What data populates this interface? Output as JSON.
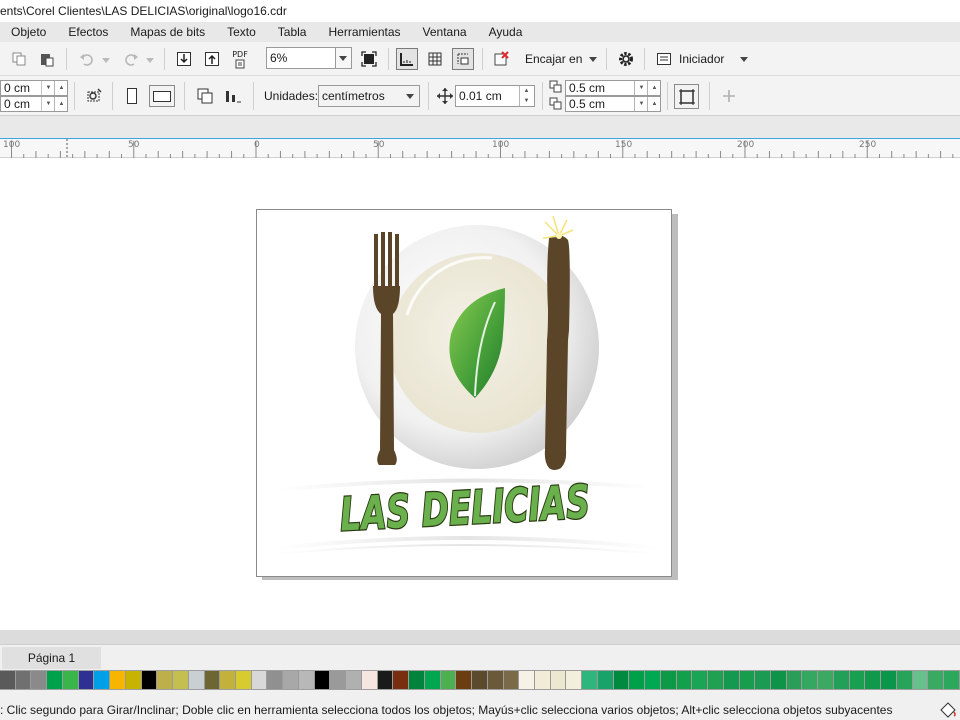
{
  "window": {
    "title": "ents\\Corel Clientes\\LAS DELICIAS\\original\\logo16.cdr"
  },
  "menu": {
    "items": [
      "Objeto",
      "Efectos",
      "Mapas de bits",
      "Texto",
      "Tabla",
      "Herramientas",
      "Ventana",
      "Ayuda"
    ]
  },
  "toolbar1": {
    "zoom_value": "6%",
    "pdf_label": "PDF",
    "snap_label": "Encajar en",
    "launcher_label": "Iniciador"
  },
  "toolbar2": {
    "pos_x_value": "0 cm",
    "pos_y_value": "0 cm",
    "units_label": "Unidades:",
    "units_value": "centímetros",
    "nudge_value": "0.01 cm",
    "dup_x_value": "0.5 cm",
    "dup_y_value": "0.5 cm"
  },
  "ruler": {
    "labels": [
      "100",
      "50",
      "0",
      "50",
      "100",
      "150",
      "200",
      "250"
    ]
  },
  "artwork": {
    "logo_text": "LAS DELICIAS",
    "colors": {
      "utensils": "#5a4528",
      "leaf_light": "#7cc04a",
      "leaf_dark": "#2e8b2e",
      "text_fill": "#6ab04c",
      "text_outline": "#2a3a12",
      "plate_rim": "#d6d6d6",
      "plate_center": "#eeeadb"
    }
  },
  "page_tabs": {
    "page_label": "Página 1"
  },
  "palette": {
    "swatches": [
      "#5a5a5a",
      "#707070",
      "#8a8a8a",
      "#00a14b",
      "#39b54a",
      "#2e3192",
      "#00a0e9",
      "#f7b500",
      "#c8b400",
      "#000000",
      "#bdb04a",
      "#c4bf4e",
      "#c8d0d4",
      "#6d6532",
      "#c2b13a",
      "#d6cc30",
      "#d8d8d8",
      "#909090",
      "#a8a8a8",
      "#b8b8b8",
      "#000000",
      "#9a9a9a",
      "#b0b0b0",
      "#f5e6e0",
      "#1a1a1a",
      "#7a2e10",
      "#00843d",
      "#00a650",
      "#4caf50",
      "#6b3e12",
      "#5c4a2e",
      "#6a5a3a",
      "#7a6a48",
      "#f7f2e8",
      "#f0ecd8",
      "#ece8d0",
      "#f2f0dc",
      "#2eb67d",
      "#17a36a",
      "#008a40",
      "#00a04a",
      "#00a852",
      "#0c9a48",
      "#12a04c",
      "#1aa455",
      "#20a050",
      "#149950",
      "#189c4e",
      "#1a9a52",
      "#0e9448",
      "#2a9e58",
      "#34a860",
      "#3ca862",
      "#22a05a",
      "#18a050",
      "#10994a",
      "#0a964a",
      "#25a45a",
      "#68c08c",
      "#3aaa62",
      "#2aa85c"
    ]
  },
  "status": {
    "hint": ": Clic segundo para Girar/Inclinar; Doble clic en herramienta selecciona todos los objetos; Mayús+clic selecciona varios objetos; Alt+clic selecciona objetos subyacentes"
  }
}
